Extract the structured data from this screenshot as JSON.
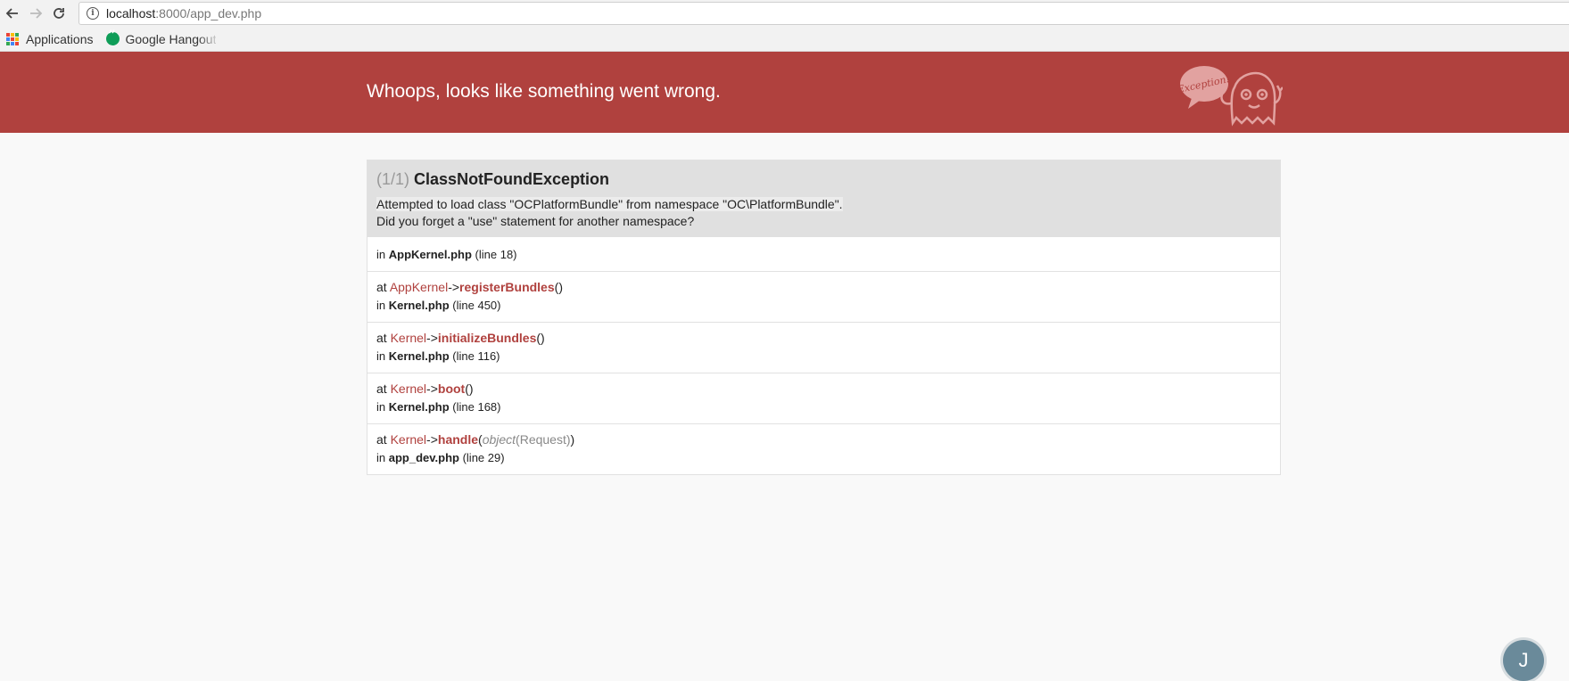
{
  "browser": {
    "url_host": "localhost",
    "url_rest": ":8000/app_dev.php",
    "bookmarks": [
      {
        "label": "Applications",
        "icon": "apps-grid-icon"
      },
      {
        "label": "Google Hangout",
        "icon": "hangouts-icon"
      }
    ]
  },
  "header": {
    "title": "Whoops, looks like something went wrong.",
    "logo_text": "Exception!",
    "background": "#b0413e"
  },
  "exception": {
    "count": "(1/1)",
    "class": "ClassNotFoundException",
    "message_line1": "Attempted to load class \"OCPlatformBundle\" from namespace \"OC\\PlatformBundle\".",
    "message_line2": "Did you forget a \"use\" statement for another namespace?"
  },
  "trace": {
    "first": {
      "prefix": "in",
      "file": "AppKernel.php",
      "line": "(line 18)"
    },
    "frames": [
      {
        "at": "at",
        "cls": "AppKernel",
        "arrow": "->",
        "fn": "registerBundles",
        "open": "(",
        "close": ")",
        "arg_type": "",
        "arg_val": "",
        "in": "in",
        "file": "Kernel.php",
        "line": "(line 450)"
      },
      {
        "at": "at",
        "cls": "Kernel",
        "arrow": "->",
        "fn": "initializeBundles",
        "open": "(",
        "close": ")",
        "arg_type": "",
        "arg_val": "",
        "in": "in",
        "file": "Kernel.php",
        "line": "(line 116)"
      },
      {
        "at": "at",
        "cls": "Kernel",
        "arrow": "->",
        "fn": "boot",
        "open": "(",
        "close": ")",
        "arg_type": "",
        "arg_val": "",
        "in": "in",
        "file": "Kernel.php",
        "line": "(line 168)"
      },
      {
        "at": "at",
        "cls": "Kernel",
        "arrow": "->",
        "fn": "handle",
        "open": "(",
        "close": ")",
        "arg_type": "object",
        "arg_val": "(Request)",
        "in": "in",
        "file": "app_dev.php",
        "line": "(line 29)"
      }
    ]
  },
  "avatar": {
    "initial": "J",
    "color": "#6a8a9a"
  }
}
